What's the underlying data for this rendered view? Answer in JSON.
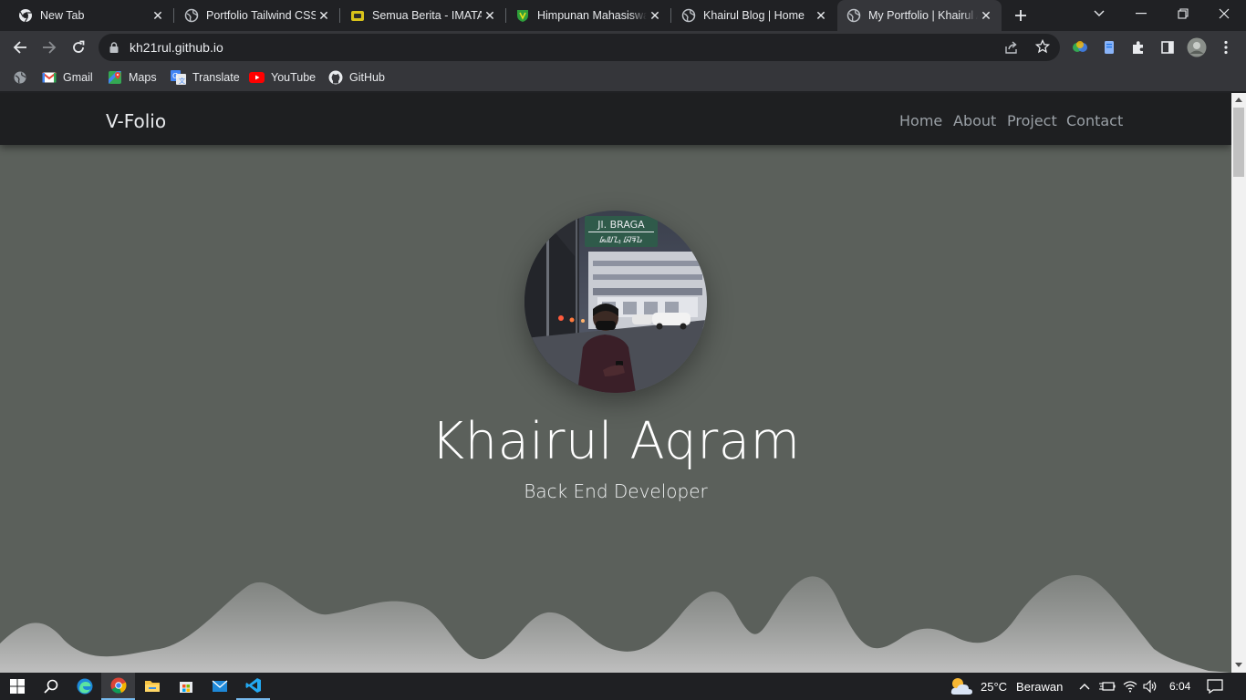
{
  "browser": {
    "tabs": [
      {
        "title": "New Tab",
        "icon": "chrome-icon",
        "active": false
      },
      {
        "title": "Portfolio Tailwind CSS",
        "icon": "globe-icon",
        "active": false
      },
      {
        "title": "Semua Berita - IMATA",
        "icon": "imata-icon",
        "active": false
      },
      {
        "title": "Himpunan Mahasiswa",
        "icon": "shield-icon",
        "active": false
      },
      {
        "title": "Khairul Blog | Home",
        "icon": "globe-icon",
        "active": false
      },
      {
        "title": "My Portfolio | Khairul A",
        "icon": "globe-icon",
        "active": true
      }
    ],
    "url": "kh21rul.github.io",
    "bookmarks": [
      {
        "label": "",
        "icon": "globe-icon"
      },
      {
        "label": "Gmail",
        "icon": "gmail-icon"
      },
      {
        "label": "Maps",
        "icon": "maps-icon"
      },
      {
        "label": "Translate",
        "icon": "translate-icon"
      },
      {
        "label": "YouTube",
        "icon": "youtube-icon"
      },
      {
        "label": "GitHub",
        "icon": "github-icon"
      }
    ]
  },
  "site": {
    "brand": "V-Folio",
    "nav": [
      "Home",
      "About",
      "Project",
      "Contact"
    ],
    "hero": {
      "name": "Khairul Aqram",
      "role": "Back End Developer",
      "photo_sign_top": "Jl. BRAGA",
      "photo_sign_bottom": "ᮏᮜᮔ᮪ ᮘᮛᮌ"
    },
    "colors": {
      "hero_bg": "#5b605b",
      "navbar_bg": "#1e1f21",
      "wave": "#bdbdbd"
    }
  },
  "taskbar": {
    "weather_temp": "25°C",
    "weather_desc": "Berawan",
    "time": "6:04"
  }
}
